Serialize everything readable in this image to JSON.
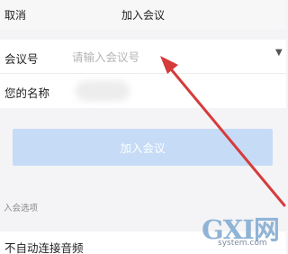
{
  "header": {
    "cancel_label": "取消",
    "title": "加入会议"
  },
  "form": {
    "meeting_id": {
      "label": "会议号",
      "placeholder": "请输入会议号"
    },
    "name": {
      "label": "您的名称"
    },
    "dropdown_icon": "chevron-down-icon"
  },
  "join_button_label": "加入会议",
  "options": {
    "section_label": "入会选项",
    "items": [
      {
        "label": "不自动连接音频"
      }
    ]
  },
  "annotation": {
    "arrow_color": "#d63b3b"
  },
  "watermark": {
    "logo_text": "GXI网",
    "url_text": "system.com"
  },
  "colors": {
    "button_bg": "#c6dbf6",
    "accent": "#4a8ee8",
    "background": "#f4f4f6"
  }
}
